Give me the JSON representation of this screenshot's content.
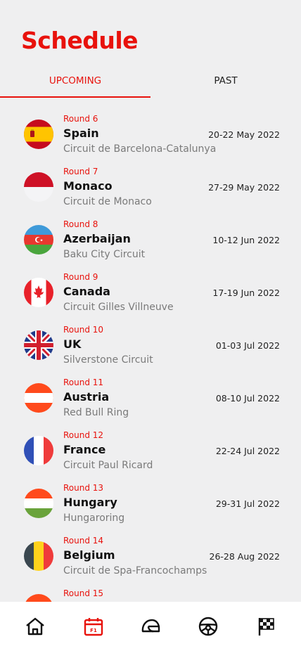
{
  "header": {
    "title": "Schedule"
  },
  "tabs": [
    {
      "label": "UPCOMING",
      "active": true
    },
    {
      "label": "PAST",
      "active": false
    }
  ],
  "colors": {
    "accent": "#e8120c",
    "background": "#efeff0",
    "muted": "#7a7a7a"
  },
  "races": [
    {
      "round": "Round 6",
      "country": "Spain",
      "circuit": "Circuit de Barcelona-Catalunya",
      "date": "20-22 May 2022",
      "flag": "spain-flag-icon"
    },
    {
      "round": "Round 7",
      "country": "Monaco",
      "circuit": "Circuit de Monaco",
      "date": "27-29 May 2022",
      "flag": "monaco-flag-icon"
    },
    {
      "round": "Round 8",
      "country": "Azerbaijan",
      "circuit": "Baku City Circuit",
      "date": "10-12 Jun 2022",
      "flag": "azerbaijan-flag-icon"
    },
    {
      "round": "Round 9",
      "country": "Canada",
      "circuit": "Circuit Gilles Villneuve",
      "date": "17-19 Jun 2022",
      "flag": "canada-flag-icon"
    },
    {
      "round": "Round 10",
      "country": "UK",
      "circuit": "Silverstone Circuit",
      "date": "01-03 Jul 2022",
      "flag": "uk-flag-icon"
    },
    {
      "round": "Round 11",
      "country": "Austria",
      "circuit": "Red Bull Ring",
      "date": "08-10 Jul 2022",
      "flag": "austria-flag-icon"
    },
    {
      "round": "Round 12",
      "country": "France",
      "circuit": "Circuit Paul Ricard",
      "date": "22-24 Jul 2022",
      "flag": "france-flag-icon"
    },
    {
      "round": "Round 13",
      "country": "Hungary",
      "circuit": "Hungaroring",
      "date": "29-31 Jul 2022",
      "flag": "hungary-flag-icon"
    },
    {
      "round": "Round 14",
      "country": "Belgium",
      "circuit": "Circuit de Spa-Francochamps",
      "date": "26-28 Aug 2022",
      "flag": "belgium-flag-icon"
    },
    {
      "round": "Round 15",
      "country": "",
      "circuit": "",
      "date": "",
      "flag": "netherlands-flag-icon"
    }
  ],
  "bottom_nav": [
    {
      "icon": "home-icon",
      "active": false
    },
    {
      "icon": "calendar-icon",
      "active": true
    },
    {
      "icon": "helmet-icon",
      "active": false
    },
    {
      "icon": "steering-wheel-icon",
      "active": false
    },
    {
      "icon": "checkered-flag-icon",
      "active": false
    }
  ]
}
